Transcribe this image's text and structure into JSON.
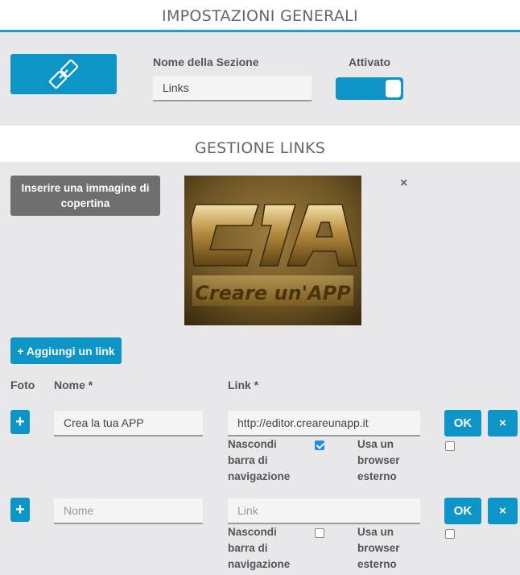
{
  "general": {
    "title": "IMPOSTAZIONI GENERALI",
    "icon": "link-icon",
    "section_name_label": "Nome della Sezione",
    "section_name_value": "Links",
    "active_label": "Attivato",
    "active": true
  },
  "links_section": {
    "title": "GESTIONE LINKS",
    "cover_button_label": "Inserire una immagine di copertina",
    "cover_image": {
      "logo_text": "C1A",
      "caption": "Creare un'APP"
    },
    "remove_cover": "×",
    "add_link_label": "+ Aggiungi un link"
  },
  "columns": {
    "foto": "Foto",
    "nome": "Nome *",
    "link": "Link *"
  },
  "rows": [
    {
      "plus": "+",
      "name_value": "Crea la tua APP",
      "name_placeholder": "Nome",
      "link_value": "http://editor.creareunapp.it",
      "link_placeholder": "Link",
      "hide_nav_label": "Nascondi barra di navigazione",
      "hide_nav_checked": true,
      "external_label": "Usa un browser esterno",
      "external_checked": false,
      "ok_label": "OK",
      "delete_label": "×"
    },
    {
      "plus": "+",
      "name_value": "",
      "name_placeholder": "Nome",
      "link_value": "",
      "link_placeholder": "Link",
      "hide_nav_label": "Nascondi barra di navigazione",
      "hide_nav_checked": false,
      "external_label": "Usa un browser esterno",
      "external_checked": false,
      "ok_label": "OK",
      "delete_label": "×"
    }
  ],
  "colors": {
    "accent": "#0d95c8",
    "background": "#e8e8ea",
    "header_bg": "#ffffff",
    "grey_button": "#6f6f6f"
  }
}
